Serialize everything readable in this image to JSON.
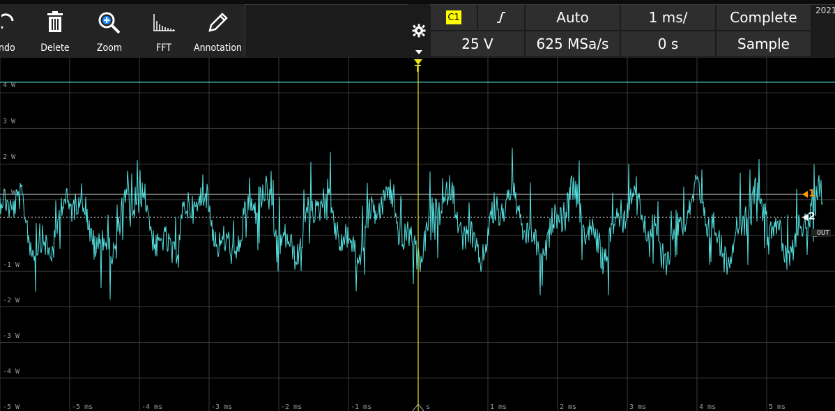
{
  "toolbar": {
    "buttons": [
      {
        "label": "ndo",
        "icon": "undo-icon"
      },
      {
        "label": "Delete",
        "icon": "trash-icon"
      },
      {
        "label": "Zoom",
        "icon": "zoom-icon"
      },
      {
        "label": "FFT",
        "icon": "fft-icon"
      },
      {
        "label": "Annotation",
        "icon": "pencil-icon"
      }
    ],
    "settings_icon": "gear-icon",
    "year": "2021"
  },
  "status": {
    "channel": "C1",
    "trigger_slope_icon": "rising-edge-icon",
    "trigger_mode": "Auto",
    "time_scale": "1 ms/",
    "acq_state": "Complete",
    "vertical_scale": "25 V",
    "sample_rate": "625 MSa/s",
    "time_offset": "0 s",
    "acq_mode": "Sample"
  },
  "scope": {
    "trigger_marker": "T",
    "y_labels": [
      "4 W",
      "3 W",
      "2 W",
      "1 W",
      "-1 W",
      "-2 W",
      "-3 W",
      "-4 W",
      "-5 W"
    ],
    "x_labels": [
      "-5 ms",
      "-4 ms",
      "-3 ms",
      "-2 ms",
      "-1 ms",
      "s",
      "1 ms",
      "2 ms",
      "3 ms",
      "4 ms",
      "5 ms"
    ],
    "marker1": "1",
    "marker2": "2",
    "out_label": "_OUT",
    "trace_color": "#56e3e3",
    "trigger_color": "#e6e61a",
    "grid_color": "#3c3c3c"
  }
}
